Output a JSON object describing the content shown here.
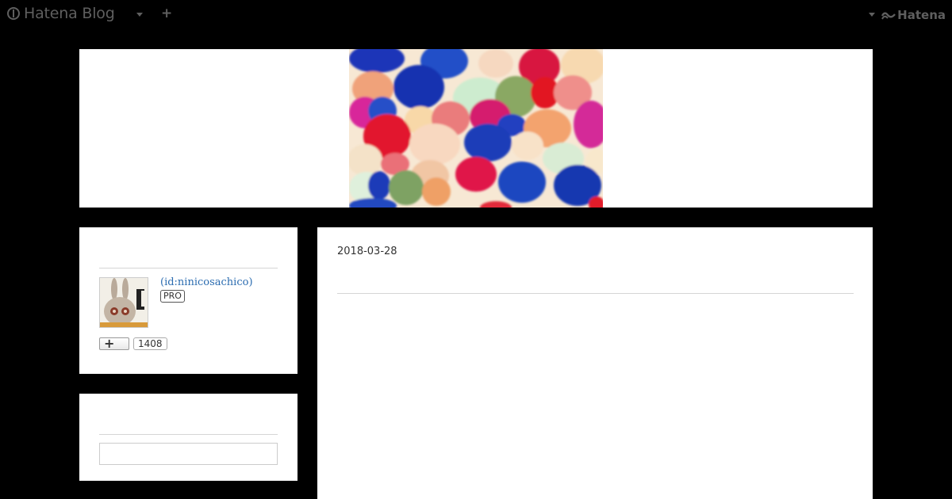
{
  "topbar": {
    "brand": "Hatena Blog",
    "right_brand": "Hatena"
  },
  "sidebar": {
    "profile": {
      "user_id": "(id:ninicosachico)",
      "badge": "PRO",
      "follow_count": "1408"
    },
    "search": {
      "placeholder": ""
    }
  },
  "main": {
    "date": "2018-03-28"
  },
  "icons": {
    "brand": "hatena-blog-logo-icon",
    "dropdown": "chevron-down-icon",
    "add": "plus-icon",
    "follow": "plus-icon"
  }
}
